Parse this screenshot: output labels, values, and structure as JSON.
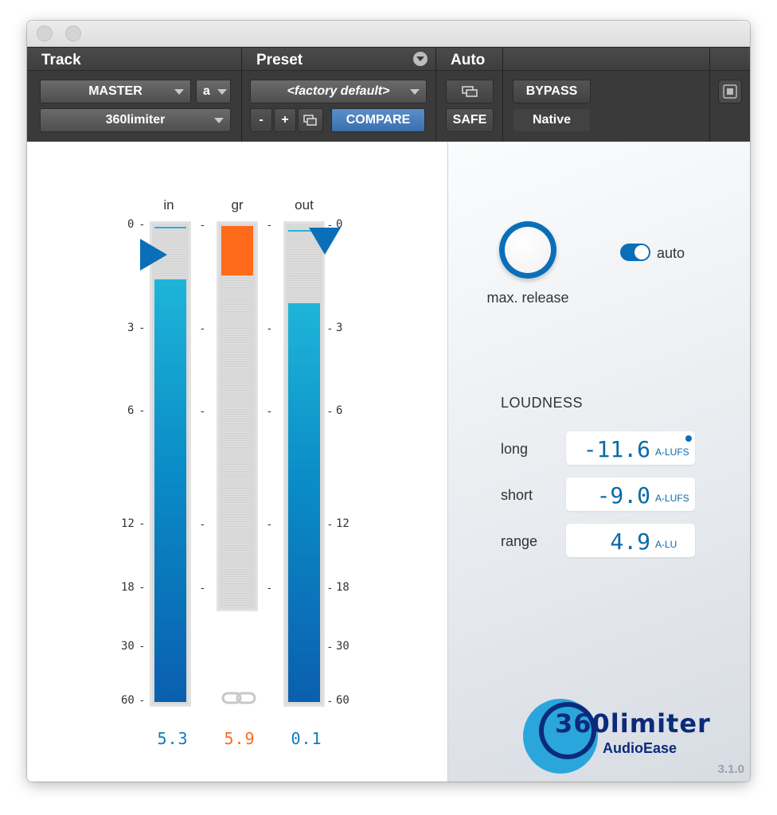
{
  "host": {
    "track": {
      "title": "Track",
      "track_name": "MASTER",
      "channel": "a",
      "plugin_name": "360limiter"
    },
    "preset": {
      "title": "Preset",
      "preset_name": "<factory default>",
      "minus": "-",
      "plus": "+",
      "compare": "COMPARE"
    },
    "auto": {
      "title": "Auto",
      "safe": "SAFE"
    },
    "misc": {
      "bypass": "BYPASS",
      "native": "Native"
    }
  },
  "meters": {
    "in": {
      "label": "in",
      "value": "5.3",
      "color": "#0a7cc0"
    },
    "gr": {
      "label": "gr",
      "value": "5.9",
      "color": "#ff6a1a"
    },
    "out": {
      "label": "out",
      "value": "0.1",
      "color": "#0a7cc0"
    },
    "scale_left": [
      "0",
      "3",
      "6",
      "12",
      "18",
      "30",
      "60"
    ],
    "scale_right": [
      "0",
      "3",
      "6",
      "12",
      "18",
      "30",
      "60"
    ],
    "dash": "-"
  },
  "controls": {
    "max_release_label": "max. release",
    "auto_label": "auto",
    "auto_on": true
  },
  "loudness": {
    "heading": "LOUDNESS",
    "rows": [
      {
        "label": "long",
        "value": "-11.6",
        "unit": "A-LUFS"
      },
      {
        "label": "short",
        "value": "-9.0",
        "unit": "A-LUFS"
      },
      {
        "label": "range",
        "value": "4.9",
        "unit": "A-LU"
      }
    ]
  },
  "brand": {
    "logo_text": "360limiter",
    "vendor": "AudioEase",
    "version": "3.1.0"
  }
}
